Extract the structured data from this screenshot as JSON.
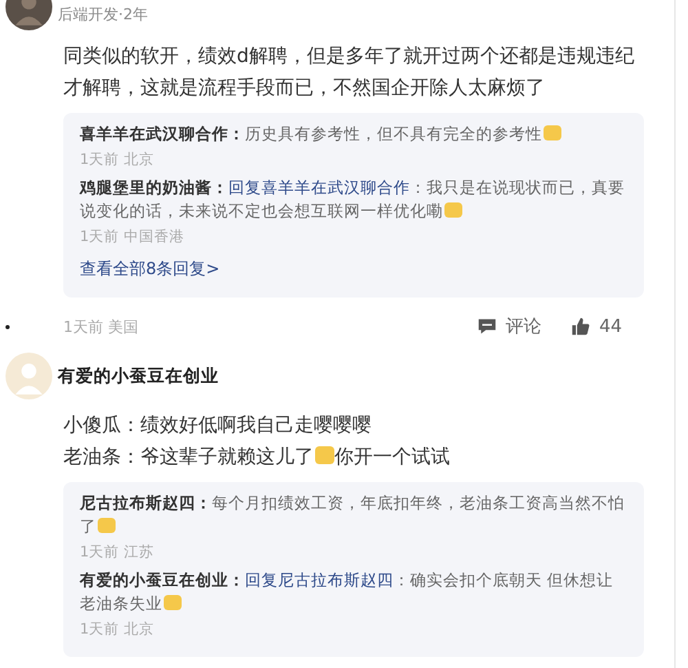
{
  "comments": [
    {
      "meta": "后端开发·2年",
      "lines": [
        {
          "parts": [
            {
              "kind": "text",
              "text": "同类似的软开，绩效d解聘，但是多年了就开过两个还都是违规违纪才解聘，这就是流程手段而已，不然国企开除人太麻烦了"
            }
          ]
        }
      ],
      "replies": [
        {
          "author": "喜羊羊在武汉聊合作：",
          "parts": [
            {
              "kind": "text",
              "text": "历史具有参考性，但不具有完全的参考性"
            },
            {
              "kind": "emoji"
            }
          ],
          "meta": "1天前 北京"
        },
        {
          "author": "鸡腿堡里的奶油酱：",
          "reply_to": "回复喜羊羊在武汉聊合作",
          "parts": [
            {
              "kind": "text",
              "text": "：我只是在说现状而已，真要说变化的话，未来说不定也会想互联网一样优化嘞"
            },
            {
              "kind": "emoji"
            }
          ],
          "meta": "1天前 中国香港"
        }
      ],
      "more_link": "查看全部8条回复>",
      "footer": {
        "meta": "1天前 美国",
        "comment_label": "评论",
        "likes": "44"
      }
    },
    {
      "name": "有爱的小蚕豆在创业",
      "lines": [
        {
          "parts": [
            {
              "kind": "text",
              "text": "小傻瓜：绩效好低啊我自己走嘤嘤嘤"
            }
          ]
        },
        {
          "parts": [
            {
              "kind": "text",
              "text": "老油条：爷这辈子就赖这儿了"
            },
            {
              "kind": "emoji"
            },
            {
              "kind": "text",
              "text": "你开一个试试"
            }
          ]
        }
      ],
      "replies": [
        {
          "author": "尼古拉布斯赵四：",
          "parts": [
            {
              "kind": "text",
              "text": "每个月扣绩效工资，年底扣年终，老油条工资高当然不怕了"
            },
            {
              "kind": "emoji"
            }
          ],
          "meta": "1天前 江苏"
        },
        {
          "author": "有爱的小蚕豆在创业：",
          "reply_to": "回复尼古拉布斯赵四",
          "parts": [
            {
              "kind": "text",
              "text": "：确实会扣个底朝天 但休想让老油条失业"
            },
            {
              "kind": "emoji"
            }
          ],
          "meta": "1天前 北京"
        }
      ]
    }
  ]
}
